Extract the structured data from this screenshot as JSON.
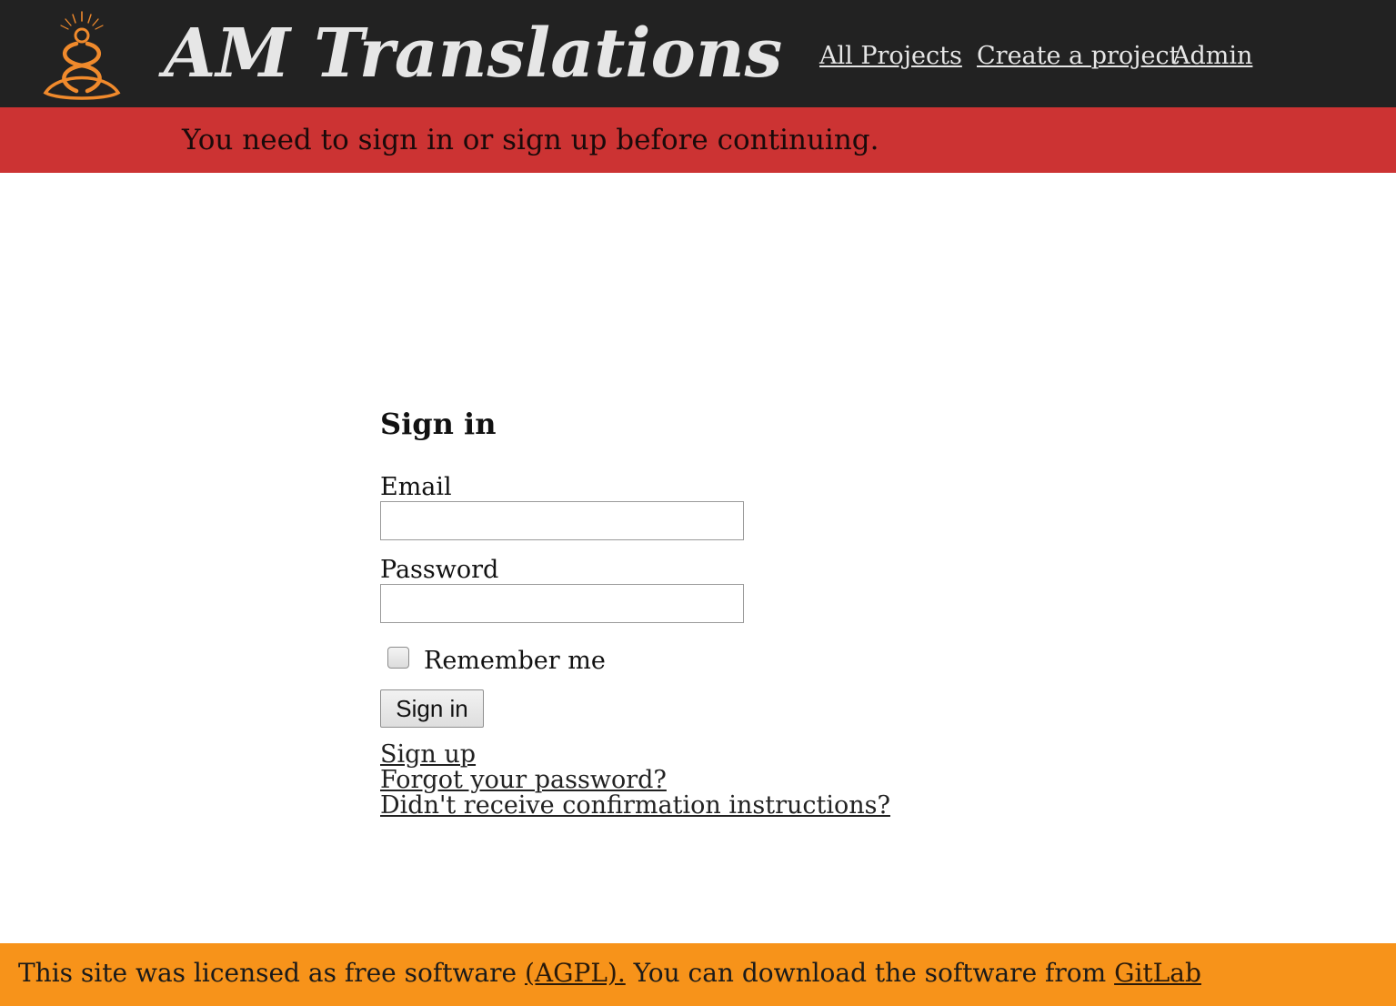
{
  "header": {
    "logo_icon": "meditating-figure-logo-icon",
    "title": "AM Translations",
    "nav": {
      "all_projects": "All Projects",
      "create_project": "Create a project",
      "admin": "Admin"
    }
  },
  "alert": {
    "message": "You need to sign in or sign up before continuing."
  },
  "signin": {
    "heading": "Sign in",
    "email_label": "Email",
    "email_value": "",
    "password_label": "Password",
    "password_value": "",
    "remember_label": "Remember me",
    "remember_checked": false,
    "submit_label": "Sign in",
    "links": {
      "sign_up": "Sign up",
      "forgot_password": "Forgot your password?",
      "confirmation": "Didn't receive confirmation instructions?"
    }
  },
  "footer": {
    "text_before": "This site was licensed as free software ",
    "license_link": "(AGPL).",
    "text_middle": " You can download the software from ",
    "gitlab_link": "GitLab"
  },
  "colors": {
    "header_bg": "#222222",
    "alert_bg": "#cc3333",
    "footer_bg": "#f7931a",
    "logo_accent": "#f08a2c"
  }
}
